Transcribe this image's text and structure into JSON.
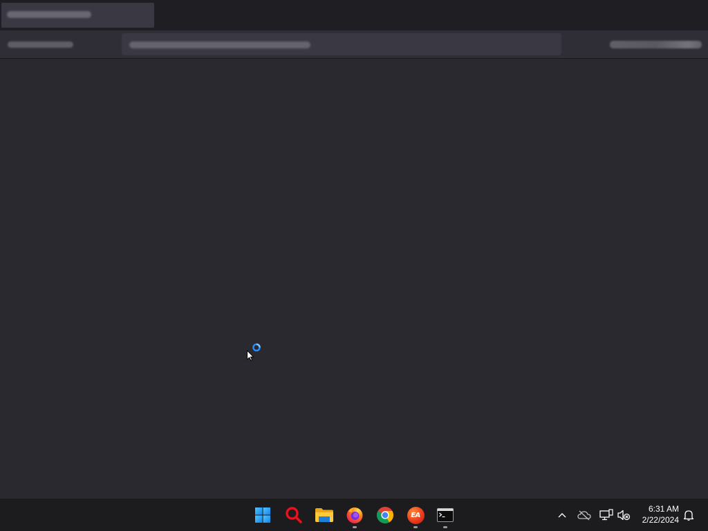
{
  "browser": {
    "state": "loading"
  },
  "taskbar": {
    "apps": [
      {
        "name": "start",
        "icon": "windows-logo-icon",
        "running": false
      },
      {
        "name": "search",
        "icon": "search-icon",
        "running": false
      },
      {
        "name": "file-explorer",
        "icon": "folder-icon",
        "running": false
      },
      {
        "name": "firefox",
        "icon": "firefox-icon",
        "running": true
      },
      {
        "name": "chrome",
        "icon": "chrome-icon",
        "running": false
      },
      {
        "name": "ea",
        "icon": "ea-icon",
        "running": true
      },
      {
        "name": "terminal",
        "icon": "terminal-icon",
        "running": true
      }
    ],
    "ea_label": "EA",
    "tray": {
      "icons": [
        "chevron-up-icon",
        "onedrive-offline-icon",
        "network-icon",
        "volume-muted-icon",
        "notification-bell-icon"
      ]
    },
    "clock": {
      "time": "6:31 AM",
      "date": "2/22/2024"
    }
  },
  "colors": {
    "desktop_bg": "#2a2930",
    "taskbar_bg": "#1c1c1e",
    "accent": "#0078d4"
  }
}
